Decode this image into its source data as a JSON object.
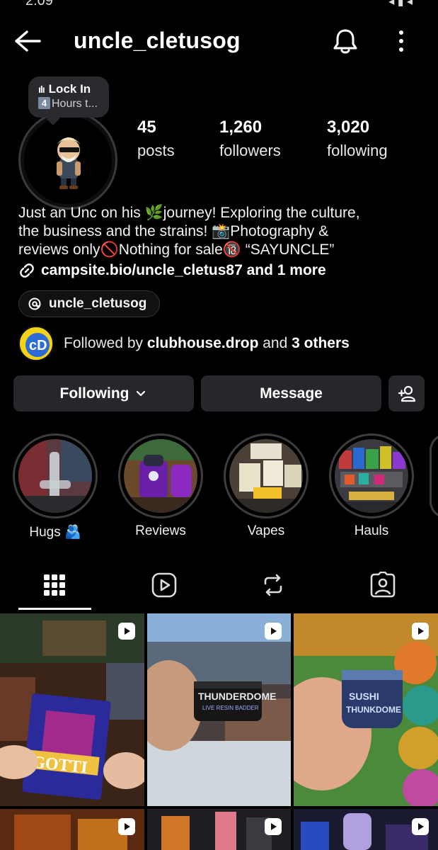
{
  "status_bar": {
    "time": "2:09",
    "right": "◂ ▮ ◂"
  },
  "header": {
    "username": "uncle_cletusog"
  },
  "note": {
    "title": "Lock In",
    "badge": "4",
    "text": "Hours t..."
  },
  "stats": [
    {
      "value": "45",
      "label": "posts"
    },
    {
      "value": "1,260",
      "label": "followers"
    },
    {
      "value": "3,020",
      "label": "following"
    }
  ],
  "bio": {
    "line1": "Just an Unc on his 🌿journey! Exploring the culture,",
    "line2": "the business and the strains! 📸Photography &",
    "line3": "reviews only🚫Nothing for sale🔞 “SAYUNCLE”"
  },
  "link": {
    "text": "campsite.bio/uncle_cletus87 and 1 more"
  },
  "threads": {
    "handle": "uncle_cletusog"
  },
  "followed_by": {
    "prefix": "Followed by ",
    "user": "clubhouse.drop",
    "middle": " and ",
    "others": "3 others"
  },
  "buttons": {
    "following": "Following",
    "message": "Message"
  },
  "highlights": [
    {
      "label": "Hugs 🫂"
    },
    {
      "label": "Reviews"
    },
    {
      "label": "Vapes"
    },
    {
      "label": "Hauls"
    }
  ],
  "tabs": [
    "grid-icon",
    "reels-icon",
    "reposts-icon",
    "tagged-icon"
  ],
  "colors": {
    "background": "#000000",
    "button": "#26272b",
    "ring": "#3d3d3d"
  }
}
